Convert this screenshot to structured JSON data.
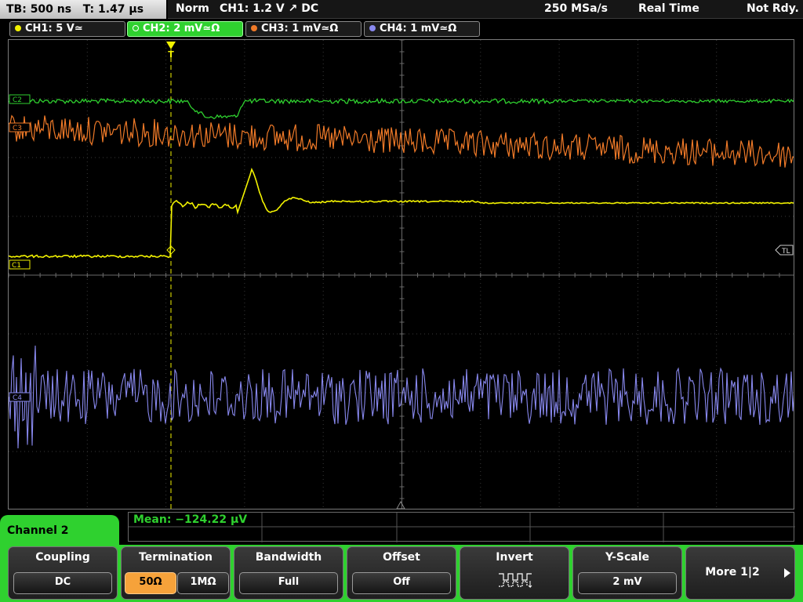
{
  "status": {
    "timebase": "TB: 500 ns",
    "trigger_time": "T: 1.47 µs",
    "mode": "Norm",
    "trigger_info": "CH1: 1.2 V ↗ DC",
    "sample_rate": "250 MSa/s",
    "acq_mode": "Real Time",
    "ready_state": "Not Rdy."
  },
  "channels": [
    {
      "label": "CH1: 5 V≃",
      "color": "#f2f200",
      "active": false
    },
    {
      "label": "CH2: 2 mV≃Ω",
      "color": "#2fd12f",
      "active": true
    },
    {
      "label": "CH3: 1 mV≃Ω",
      "color": "#f07a28",
      "active": false
    },
    {
      "label": "CH4: 1 mV≃Ω",
      "color": "#8888ee",
      "active": false
    }
  ],
  "markers": {
    "ch1": "C1",
    "ch2": "C2",
    "ch3": "C3",
    "ch4": "C4",
    "trigger_level": "TL",
    "trigger": "T"
  },
  "measurement": {
    "mean": "Mean: −124.22 µV"
  },
  "menu": {
    "title": "Channel 2",
    "coupling": {
      "title": "Coupling",
      "value": "DC"
    },
    "termination": {
      "title": "Termination",
      "options": [
        "50Ω",
        "1MΩ"
      ],
      "selected": "50Ω"
    },
    "bandwidth": {
      "title": "Bandwidth",
      "value": "Full"
    },
    "offset": {
      "title": "Offset",
      "value": "Off"
    },
    "invert": {
      "title": "Invert",
      "icon": "inverted-square-wave-icon"
    },
    "yscale": {
      "title": "Y-Scale",
      "value": "2 mV"
    },
    "more": {
      "label": "More 1|2",
      "icon": "arrow-right-icon"
    }
  }
}
